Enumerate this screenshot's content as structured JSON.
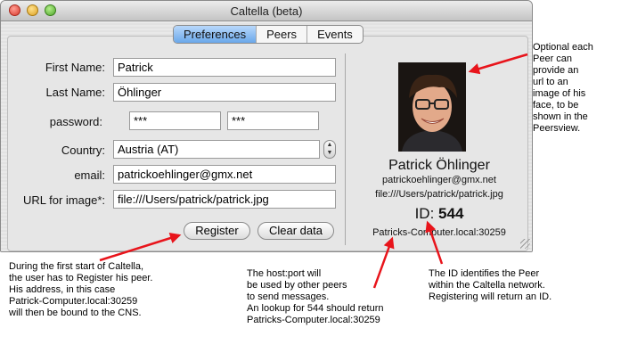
{
  "window": {
    "title": "Caltella (beta)"
  },
  "tabs": [
    {
      "label": "Preferences",
      "active": true
    },
    {
      "label": "Peers",
      "active": false
    },
    {
      "label": "Events",
      "active": false
    }
  ],
  "form": {
    "first_name_label": "First Name:",
    "first_name_value": "Patrick",
    "last_name_label": "Last Name:",
    "last_name_value": "Öhlinger",
    "password_label": "password:",
    "password_value": "***",
    "password_confirm_value": "***",
    "country_label": "Country:",
    "country_value": "Austria (AT)",
    "email_label": "email:",
    "email_value": "patrickoehlinger@gmx.net",
    "url_label": "URL for image*:",
    "url_value": "file:///Users/patrick/patrick.jpg"
  },
  "buttons": {
    "register": "Register",
    "clear": "Clear data"
  },
  "profile": {
    "name": "Patrick Öhlinger",
    "email": "patrickoehlinger@gmx.net",
    "image_url": "file:///Users/patrick/patrick.jpg",
    "id_label": "ID:",
    "id_value": "544",
    "host": "Patricks-Computer.local:30259"
  },
  "annotations": {
    "image_note": "Optional each\nPeer can\nprovide an\nurl to an\nimage of his\nface, to be\nshown in the\nPeersview.",
    "register_note": "During the first start of Caltella,\nthe user has to Register his peer.\nHis address, in this case\nPatrick-Computer.local:30259\nwill then be bound to the CNS.",
    "host_note": "The host:port will\nbe used by other peers\nto send messages.\nAn lookup for 544 should return\nPatricks-Computer.local:30259",
    "id_note": "The ID identifies the Peer\nwithin the Caltella network.\nRegistering will return an ID."
  },
  "colors": {
    "arrow": "#e8141b",
    "tab_active": "#6aa7ea"
  }
}
